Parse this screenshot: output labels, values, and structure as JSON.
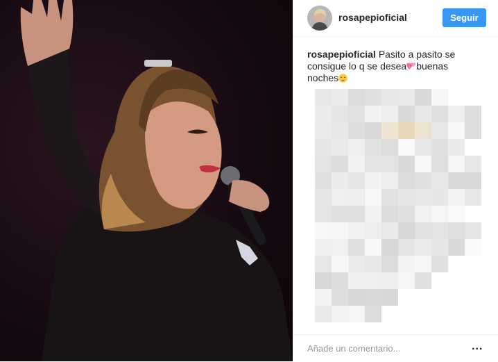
{
  "post": {
    "username": "rosapepioficial",
    "follow_label": "Seguir",
    "caption_user": "rosapepioficial",
    "caption_text": "Pasito a pasito se consigue lo q se desea",
    "caption_after_heart": "buenas noches",
    "caption_emojis": [
      "two-hearts-icon",
      "relieved-face-icon"
    ],
    "comment_placeholder": "Añade un comentario...",
    "more_label": "..."
  },
  "colors": {
    "follow_button": "#3897f0",
    "text": "#262626",
    "placeholder": "#999999"
  }
}
